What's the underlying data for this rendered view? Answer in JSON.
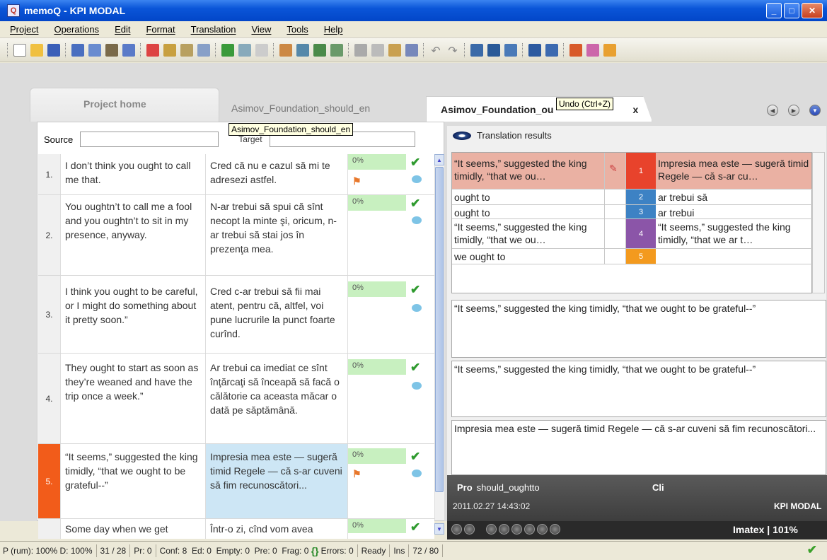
{
  "window": {
    "title": "memoQ - KPI MODAL",
    "app_icon": "Q"
  },
  "menu": [
    "Project",
    "Operations",
    "Edit",
    "Format",
    "Translation",
    "View",
    "Tools",
    "Help"
  ],
  "tabs": {
    "home": "Project home",
    "doc1": "Asimov_Foundation_should_en",
    "doc2": "Asimov_Foundation_ou",
    "doc2_suffix": "x"
  },
  "tooltips": {
    "undo": "Undo (Ctrl+Z)",
    "tab": "Asimov_Foundation_should_en"
  },
  "grid": {
    "source_label": "Source",
    "target_label": "Target",
    "rows": [
      {
        "num": "1.",
        "src": "I don’t think you ought to call me that.",
        "tgt": "Cred că nu e cazul să mi te adresezi astfel.",
        "pct": "0%"
      },
      {
        "num": "2.",
        "src": "You oughtn’t to call me a fool and you oughtn’t to sit in my presence, anyway.",
        "tgt": "N-ar trebui să spui că sînt necopt la minte şi, oricum, n-ar trebui să stai jos în prezenţa mea.",
        "pct": "0%"
      },
      {
        "num": "3.",
        "src": "I think you ought to be careful, or I might do something about it pretty soon.”",
        "tgt": "Cred c-ar trebui să fii mai atent, pentru că, altfel, voi pune lucrurile la punct foarte curînd.",
        "pct": "0%"
      },
      {
        "num": "4.",
        "src": "They ought to start as soon as they’re weaned and have the trip once a week.”",
        "tgt": "Ar trebui ca imediat ce sînt înţărcaţi să înceapă să facă o călătorie ca aceasta măcar o dată pe săptămână.",
        "pct": "0%"
      },
      {
        "num": "5.",
        "src": "“It seems,” suggested the king timidly, “that we ought to be grateful--”",
        "tgt": "Impresia mea este — sugeră timid Regele — că s-ar cuveni să fim recunoscători...",
        "pct": "0%"
      },
      {
        "num": "",
        "src": "Some day when we get",
        "tgt": "Într-o zi, cînd vom avea",
        "pct": "0%"
      }
    ]
  },
  "results": {
    "header": "Translation results",
    "rows": [
      {
        "src": "“It seems,” suggested the king timidly, “that we ou…",
        "num": "1",
        "tgt": "Impresia mea este — sugeră timid Regele — că s-ar cu…",
        "color": "#e8432c"
      },
      {
        "src": "ought to",
        "num": "2",
        "tgt": "ar trebui să",
        "color": "#3d82c4"
      },
      {
        "src": "ought to",
        "num": "3",
        "tgt": "ar trebui",
        "color": "#3d82c4"
      },
      {
        "src": "“It seems,” suggested the king timidly, “that we ou…",
        "num": "4",
        "tgt": "“It seems,” suggested the king timidly, “that we ar t…",
        "color": "#8b55a8"
      },
      {
        "src": "we ought to",
        "num": "5",
        "tgt": "",
        "color": "#f39a1e"
      }
    ]
  },
  "panes": {
    "source_preview": "“It seems,” suggested the king timidly, “that we ought to be grateful--”",
    "compare_preview": "“It seems,” suggested the king timidly, “that we ought to be grateful--”",
    "target_preview": "Impresia mea este — sugeră timid Regele — că s-ar cuveni să fim recunoscători..."
  },
  "meta": {
    "pro_label": "Pro",
    "pro_value": "should_oughtto",
    "cli_label": "Cli",
    "date": "2011.02.27 14:43:02",
    "user": "KPI MODAL",
    "engine": "Imatex",
    "zoom": "101%"
  },
  "status": {
    "rum": "P (rum): 100%",
    "d": "D: 100%",
    "counts": "31 / 28",
    "pr": "Pr: 0",
    "conf": "Conf: 8",
    "ed": "Ed: 0",
    "empty": "Empty: 0",
    "pre": "Pre: 0",
    "frag": "Frag: 0",
    "errors": "Errors: 0",
    "ready": "Ready",
    "ins": "Ins",
    "pos": "72 / 80"
  },
  "colors": {
    "active_row": "#f25c1a",
    "match_green": "#c8f0c0",
    "selected_result": "#eab1a3"
  }
}
